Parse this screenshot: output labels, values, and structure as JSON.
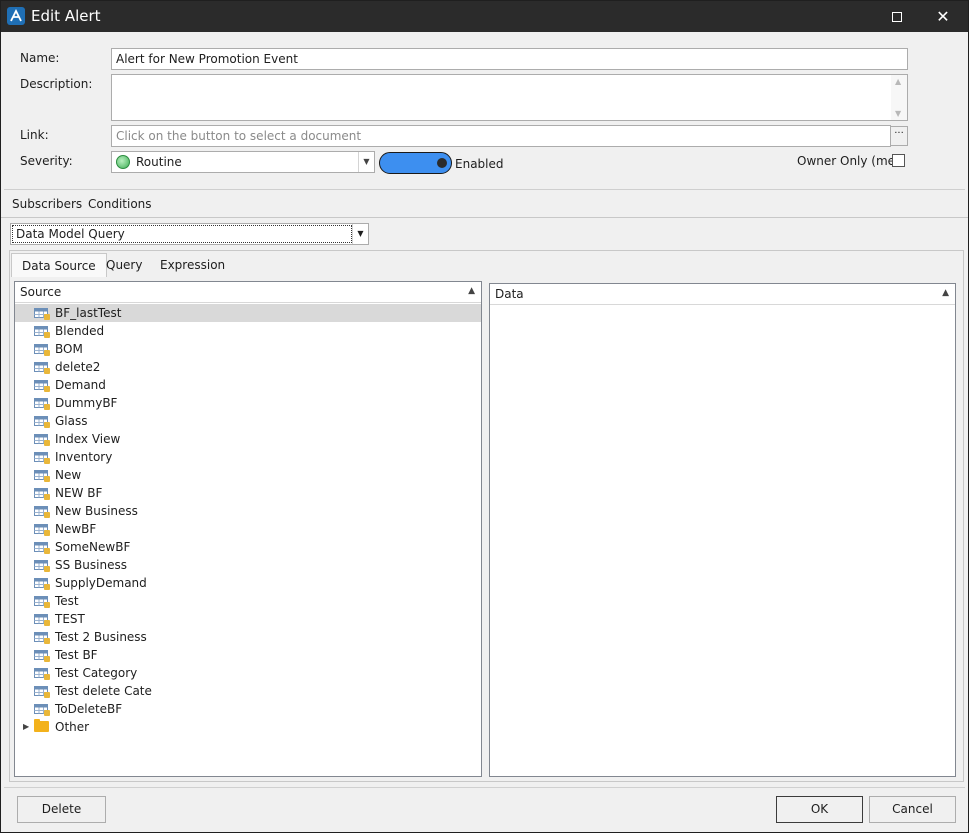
{
  "window": {
    "title": "Edit Alert",
    "maximize_label": "",
    "close_label": "✕"
  },
  "form": {
    "name_label": "Name:",
    "name_value": "Alert for New Promotion Event",
    "description_label": "Description:",
    "description_value": "",
    "link_label": "Link:",
    "link_placeholder": "Click on the button to select a document",
    "link_button_label": "···",
    "severity_label": "Severity:",
    "severity_value": "Routine",
    "enabled_label": "Enabled",
    "owner_only_label": "Owner Only (me)"
  },
  "outer_tabs": [
    {
      "label": "Subscribers"
    },
    {
      "label": "Conditions"
    }
  ],
  "query_type": "Data Model Query",
  "inner_tabs": [
    {
      "label": "Data Source"
    },
    {
      "label": "Query"
    },
    {
      "label": "Expression"
    }
  ],
  "source_pane": {
    "header": "Source",
    "items": [
      "BF_lastTest",
      "Blended",
      "BOM",
      "delete2",
      "Demand",
      "DummyBF",
      "Glass",
      "Index View",
      "Inventory",
      "New",
      "NEW BF",
      "New Business",
      "NewBF",
      "SomeNewBF",
      "SS Business",
      "SupplyDemand",
      "Test",
      "TEST",
      "Test 2 Business",
      "Test BF",
      "Test Category",
      "Test delete Cate",
      "ToDeleteBF"
    ],
    "folder": "Other",
    "selected": "BF_lastTest"
  },
  "data_pane": {
    "header": "Data"
  },
  "buttons": {
    "delete": "Delete",
    "ok": "OK",
    "cancel": "Cancel"
  },
  "colors": {
    "titlebar": "#2b2b2b",
    "toggle": "#3d8ff0",
    "folder": "#f3b21c",
    "app_icon": "#1f6fb5"
  }
}
